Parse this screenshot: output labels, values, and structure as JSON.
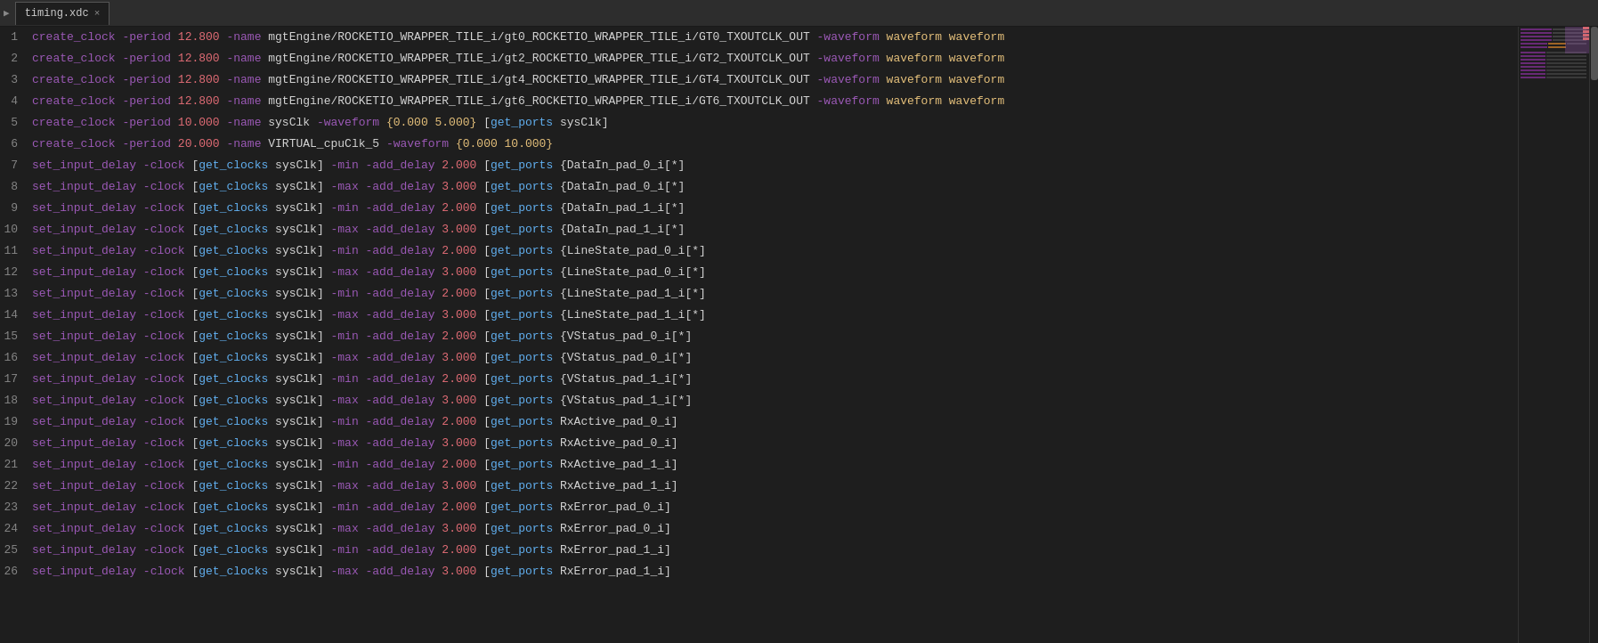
{
  "tab": {
    "filename": "timing.xdc",
    "close_label": "×"
  },
  "lines": [
    {
      "num": "1",
      "tokens": [
        {
          "type": "kw",
          "text": "create_clock"
        },
        {
          "type": "flag",
          "text": " -period "
        },
        {
          "type": "num",
          "text": "12.800"
        },
        {
          "type": "flag",
          "text": " -name "
        },
        {
          "type": "path",
          "text": "mgtEngine/ROCKETIO_WRAPPER_TILE_i/gt0_ROCKETIO_WRAPPER_TILE_i/GT0_TXOUTCLK_OUT"
        },
        {
          "type": "flag",
          "text": " -waveform "
        },
        {
          "type": "plain",
          "text": "waveform waveform"
        }
      ],
      "raw": "create_clock -period 12.800 -name mgtEngine/ROCKETIO_WRAPPER_TILE_i/gt0_ROCKETIO_WRAPPER_TILE_i/GT0_TXOUTCLK_OUT -waveform"
    },
    {
      "num": "2",
      "raw": "create_clock -period 12.800 -name mgtEngine/ROCKETIO_WRAPPER_TILE_i/gt2_ROCKETIO_WRAPPER_TILE_i/GT2_TXOUTCLK_OUT -waveform"
    },
    {
      "num": "3",
      "raw": "create_clock -period 12.800 -name mgtEngine/ROCKETIO_WRAPPER_TILE_i/gt4_ROCKETIO_WRAPPER_TILE_i/GT4_TXOUTCLK_OUT -waveform"
    },
    {
      "num": "4",
      "raw": "create_clock -period 12.800 -name mgtEngine/ROCKETIO_WRAPPER_TILE_i/gt6_ROCKETIO_WRAPPER_TILE_i/GT6_TXOUTCLK_OUT -waveform"
    },
    {
      "num": "5",
      "raw": "create_clock -period 10.000 -name sysClk -waveform {0.000 5.000} [get_ports sysClk]"
    },
    {
      "num": "6",
      "raw": "create_clock -period 20.000 -name VIRTUAL_cpuClk_5 -waveform {0.000 10.000}"
    },
    {
      "num": "7",
      "raw": "set_input_delay -clock [get_clocks sysClk] -min -add_delay 2.000 [get_ports {DataIn_pad_0_i[*]}]"
    },
    {
      "num": "8",
      "raw": "set_input_delay -clock [get_clocks sysClk] -max -add_delay 3.000 [get_ports {DataIn_pad_0_i[*]}]"
    },
    {
      "num": "9",
      "raw": "set_input_delay -clock [get_clocks sysClk] -min -add_delay 2.000 [get_ports {DataIn_pad_1_i[*]}]"
    },
    {
      "num": "10",
      "raw": "set_input_delay -clock [get_clocks sysClk] -max -add_delay 3.000 [get_ports {DataIn_pad_1_i[*]}]"
    },
    {
      "num": "11",
      "raw": "set_input_delay -clock [get_clocks sysClk] -min -add_delay 2.000 [get_ports {LineState_pad_0_i[*]}]"
    },
    {
      "num": "12",
      "raw": "set_input_delay -clock [get_clocks sysClk] -max -add_delay 3.000 [get_ports {LineState_pad_0_i[*]}]"
    },
    {
      "num": "13",
      "raw": "set_input_delay -clock [get_clocks sysClk] -min -add_delay 2.000 [get_ports {LineState_pad_1_i[*]}]"
    },
    {
      "num": "14",
      "raw": "set_input_delay -clock [get_clocks sysClk] -max -add_delay 3.000 [get_ports {LineState_pad_1_i[*]}]"
    },
    {
      "num": "15",
      "raw": "set_input_delay -clock [get_clocks sysClk] -min -add_delay 2.000 [get_ports {VStatus_pad_0_i[*]}]"
    },
    {
      "num": "16",
      "raw": "set_input_delay -clock [get_clocks sysClk] -max -add_delay 3.000 [get_ports {VStatus_pad_0_i[*]}]"
    },
    {
      "num": "17",
      "raw": "set_input_delay -clock [get_clocks sysClk] -min -add_delay 2.000 [get_ports {VStatus_pad_1_i[*]}]"
    },
    {
      "num": "18",
      "raw": "set_input_delay -clock [get_clocks sysClk] -max -add_delay 3.000 [get_ports {VStatus_pad_1_i[*]}]"
    },
    {
      "num": "19",
      "raw": "set_input_delay -clock [get_clocks sysClk] -min -add_delay 2.000 [get_ports RxActive_pad_0_i]"
    },
    {
      "num": "20",
      "raw": "set_input_delay -clock [get_clocks sysClk] -max -add_delay 3.000 [get_ports RxActive_pad_0_i]"
    },
    {
      "num": "21",
      "raw": "set_input_delay -clock [get_clocks sysClk] -min -add_delay 2.000 [get_ports RxActive_pad_1_i]"
    },
    {
      "num": "22",
      "raw": "set_input_delay -clock [get_clocks sysClk] -max -add_delay 3.000 [get_ports RxActive_pad_1_i]"
    },
    {
      "num": "23",
      "raw": "set_input_delay -clock [get_clocks sysClk] -min -add_delay 2.000 [get_ports RxError_pad_0_i]"
    },
    {
      "num": "24",
      "raw": "set_input_delay -clock [get_clocks sysClk] -max -add_delay 3.000 [get_ports RxError_pad_0_i]"
    },
    {
      "num": "25",
      "raw": "set_input_delay -clock [get_clocks sysClk] -min -add_delay 2.000 [get_ports RxError_pad_1_i]"
    },
    {
      "num": "26",
      "raw": "set_input_delay -clock [get_clocks sysClk] -max -add_delay 3.000 [get_ports RxError_pad_1_i]"
    }
  ]
}
